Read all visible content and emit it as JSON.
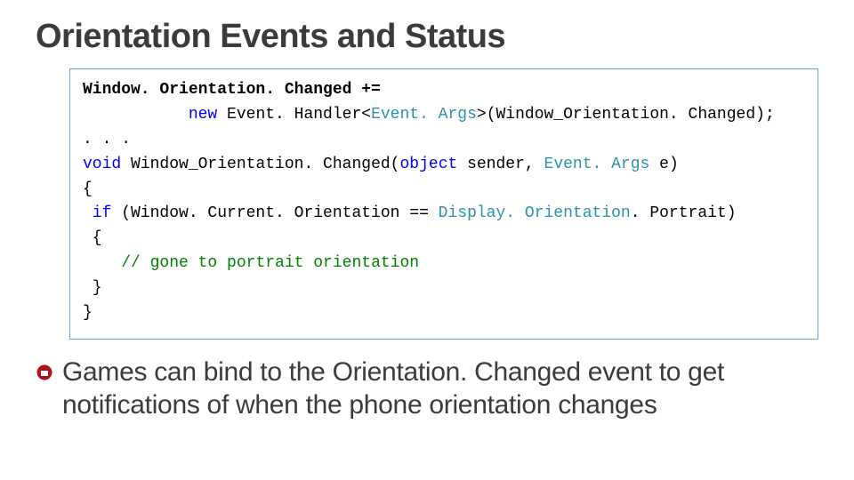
{
  "title": "Orientation Events and Status",
  "code": {
    "l1a": "Window. Orientation. Changed +=",
    "l2a": "           ",
    "l2_new": "new",
    "l2b": " Event. Handler<",
    "l2_type": "Event. Args",
    "l2c": ">(Window_Orientation. Changed);",
    "l3": ". . .",
    "l4_void": "void",
    "l4a": " Window_Orientation. Changed(",
    "l4_obj": "object",
    "l4b": " sender, ",
    "l4_etype": "Event. Args",
    "l4c": " e)",
    "l5": "{",
    "l6_if": " if",
    "l6a": " (Window. Current. Orientation == ",
    "l6_disp": "Display. Orientation",
    "l6b": ". Portrait)",
    "l7": " {",
    "l8a": "    ",
    "l8_cmt": "// gone to portrait orientation",
    "l9": " }",
    "l10": "}"
  },
  "bullet": "Games can bind to the Orientation. Changed event to get notifications of when the phone orientation changes"
}
